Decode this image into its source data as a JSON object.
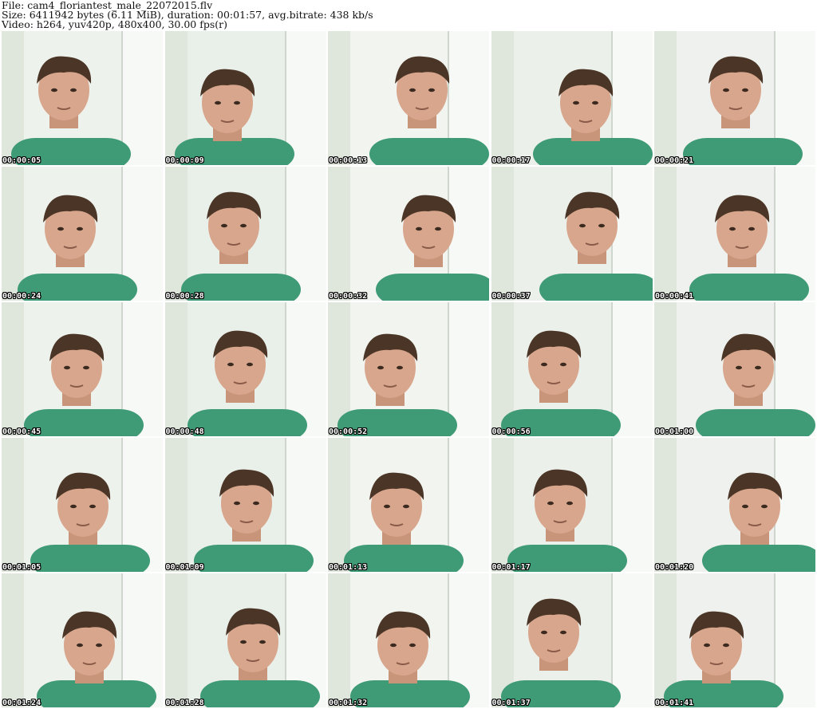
{
  "header": {
    "file_line": "File: cam4_floriantest_male_22072015.flv",
    "size_line": "Size: 6411942 bytes (6.11 MiB), duration: 00:01:57, avg.bitrate: 438 kb/s",
    "video_line": "Video: h264, yuv420p, 480x400, 30.00 fps(r)"
  },
  "frames": [
    {
      "time": "00:00:05"
    },
    {
      "time": "00:00:09"
    },
    {
      "time": "00:00:13"
    },
    {
      "time": "00:00:17"
    },
    {
      "time": "00:00:21"
    },
    {
      "time": "00:00:24"
    },
    {
      "time": "00:00:28"
    },
    {
      "time": "00:00:32"
    },
    {
      "time": "00:00:37"
    },
    {
      "time": "00:00:41"
    },
    {
      "time": "00:00:45"
    },
    {
      "time": "00:00:48"
    },
    {
      "time": "00:00:52"
    },
    {
      "time": "00:00:56"
    },
    {
      "time": "00:01:00"
    },
    {
      "time": "00:01:05"
    },
    {
      "time": "00:01:09"
    },
    {
      "time": "00:01:13"
    },
    {
      "time": "00:01:17"
    },
    {
      "time": "00:01:20"
    },
    {
      "time": "00:01:24"
    },
    {
      "time": "00:01:28"
    },
    {
      "time": "00:01:32"
    },
    {
      "time": "00:01:37"
    },
    {
      "time": "00:01:41"
    }
  ]
}
